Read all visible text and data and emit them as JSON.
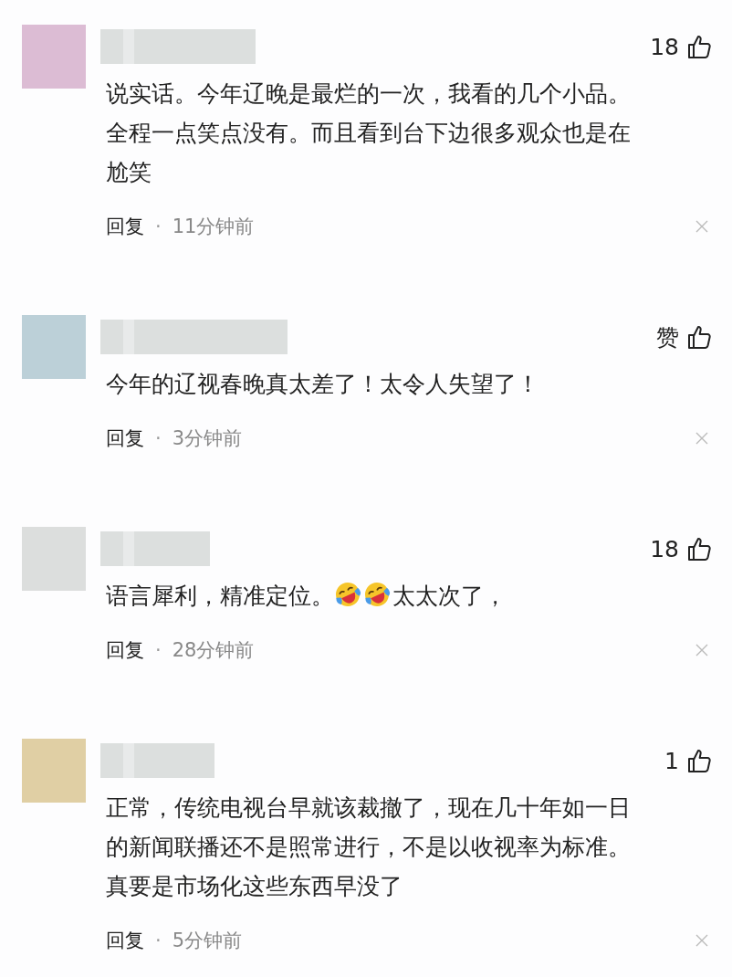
{
  "comments": [
    {
      "color": "#dcbcd4",
      "likes": "18",
      "lines": [
        [
          {
            "kind": "text",
            "text": "说实话。今年辽晚是最烂的一次，我看的几个小品。"
          }
        ],
        [
          {
            "kind": "text",
            "text": "全程一点笑点没有。而且看到台下边很多观众也是在"
          }
        ],
        [
          {
            "kind": "text",
            "text": "尬笑"
          }
        ]
      ],
      "reply": "回复",
      "separator": "·",
      "time": "11分钟前"
    },
    {
      "color": "#bcd0d8",
      "likes": "赞",
      "lines": [
        [
          {
            "kind": "text",
            "text": "今年的辽视春晚真太差了！太令人失望了！"
          }
        ]
      ],
      "reply": "回复",
      "separator": "·",
      "time": "3分钟前"
    },
    {
      "color": "#dcdedd",
      "likes": "18",
      "lines": [
        [
          {
            "kind": "text",
            "text": "语言犀利，精准定位。"
          },
          {
            "kind": "emoji"
          },
          {
            "kind": "emoji"
          },
          {
            "kind": "text",
            "text": "太太次了，"
          }
        ]
      ],
      "reply": "回复",
      "separator": "·",
      "time": "28分钟前"
    },
    {
      "color": "#e0cfa4",
      "likes": "1",
      "lines": [
        [
          {
            "kind": "text",
            "text": "正常，传统电视台早就该裁撤了，现在几十年如一日"
          }
        ],
        [
          {
            "kind": "text",
            "text": "的新闻联播还不是照常进行，不是以收视率为标准。"
          }
        ],
        [
          {
            "kind": "text",
            "text": "真要是市场化这些东西早没了"
          }
        ]
      ],
      "reply": "回复",
      "separator": "·",
      "time": "5分钟前"
    }
  ]
}
